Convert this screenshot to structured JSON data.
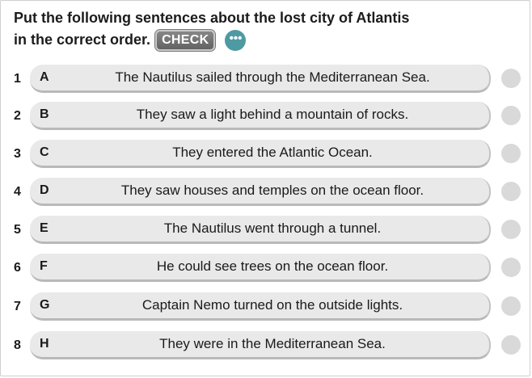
{
  "instructions": {
    "line1": "Put the following sentences about the lost city of Atlantis",
    "line2": "in the correct order."
  },
  "check_button": {
    "label": "CHECK"
  },
  "more_button": {
    "label": "•••",
    "icon": "more-dots-icon",
    "color": "#4e9aa3"
  },
  "rows": [
    {
      "number": "1",
      "letter": "A",
      "sentence": "The Nautilus sailed through the Mediterranean Sea."
    },
    {
      "number": "2",
      "letter": "B",
      "sentence": "They saw a light behind a mountain of rocks."
    },
    {
      "number": "3",
      "letter": "C",
      "sentence": "They entered the Atlantic Ocean."
    },
    {
      "number": "4",
      "letter": "D",
      "sentence": "They saw houses and temples on the ocean floor."
    },
    {
      "number": "5",
      "letter": "E",
      "sentence": "The Nautilus went through a tunnel."
    },
    {
      "number": "6",
      "letter": "F",
      "sentence": "He could see trees on the ocean floor."
    },
    {
      "number": "7",
      "letter": "G",
      "sentence": "Captain Nemo turned on the outside lights."
    },
    {
      "number": "8",
      "letter": "H",
      "sentence": "They were in the Mediterranean Sea."
    }
  ],
  "colors": {
    "pill_background": "#e9e9e9",
    "status_indicator": "#d9d9d9",
    "check_button": "#6f6f6f"
  }
}
